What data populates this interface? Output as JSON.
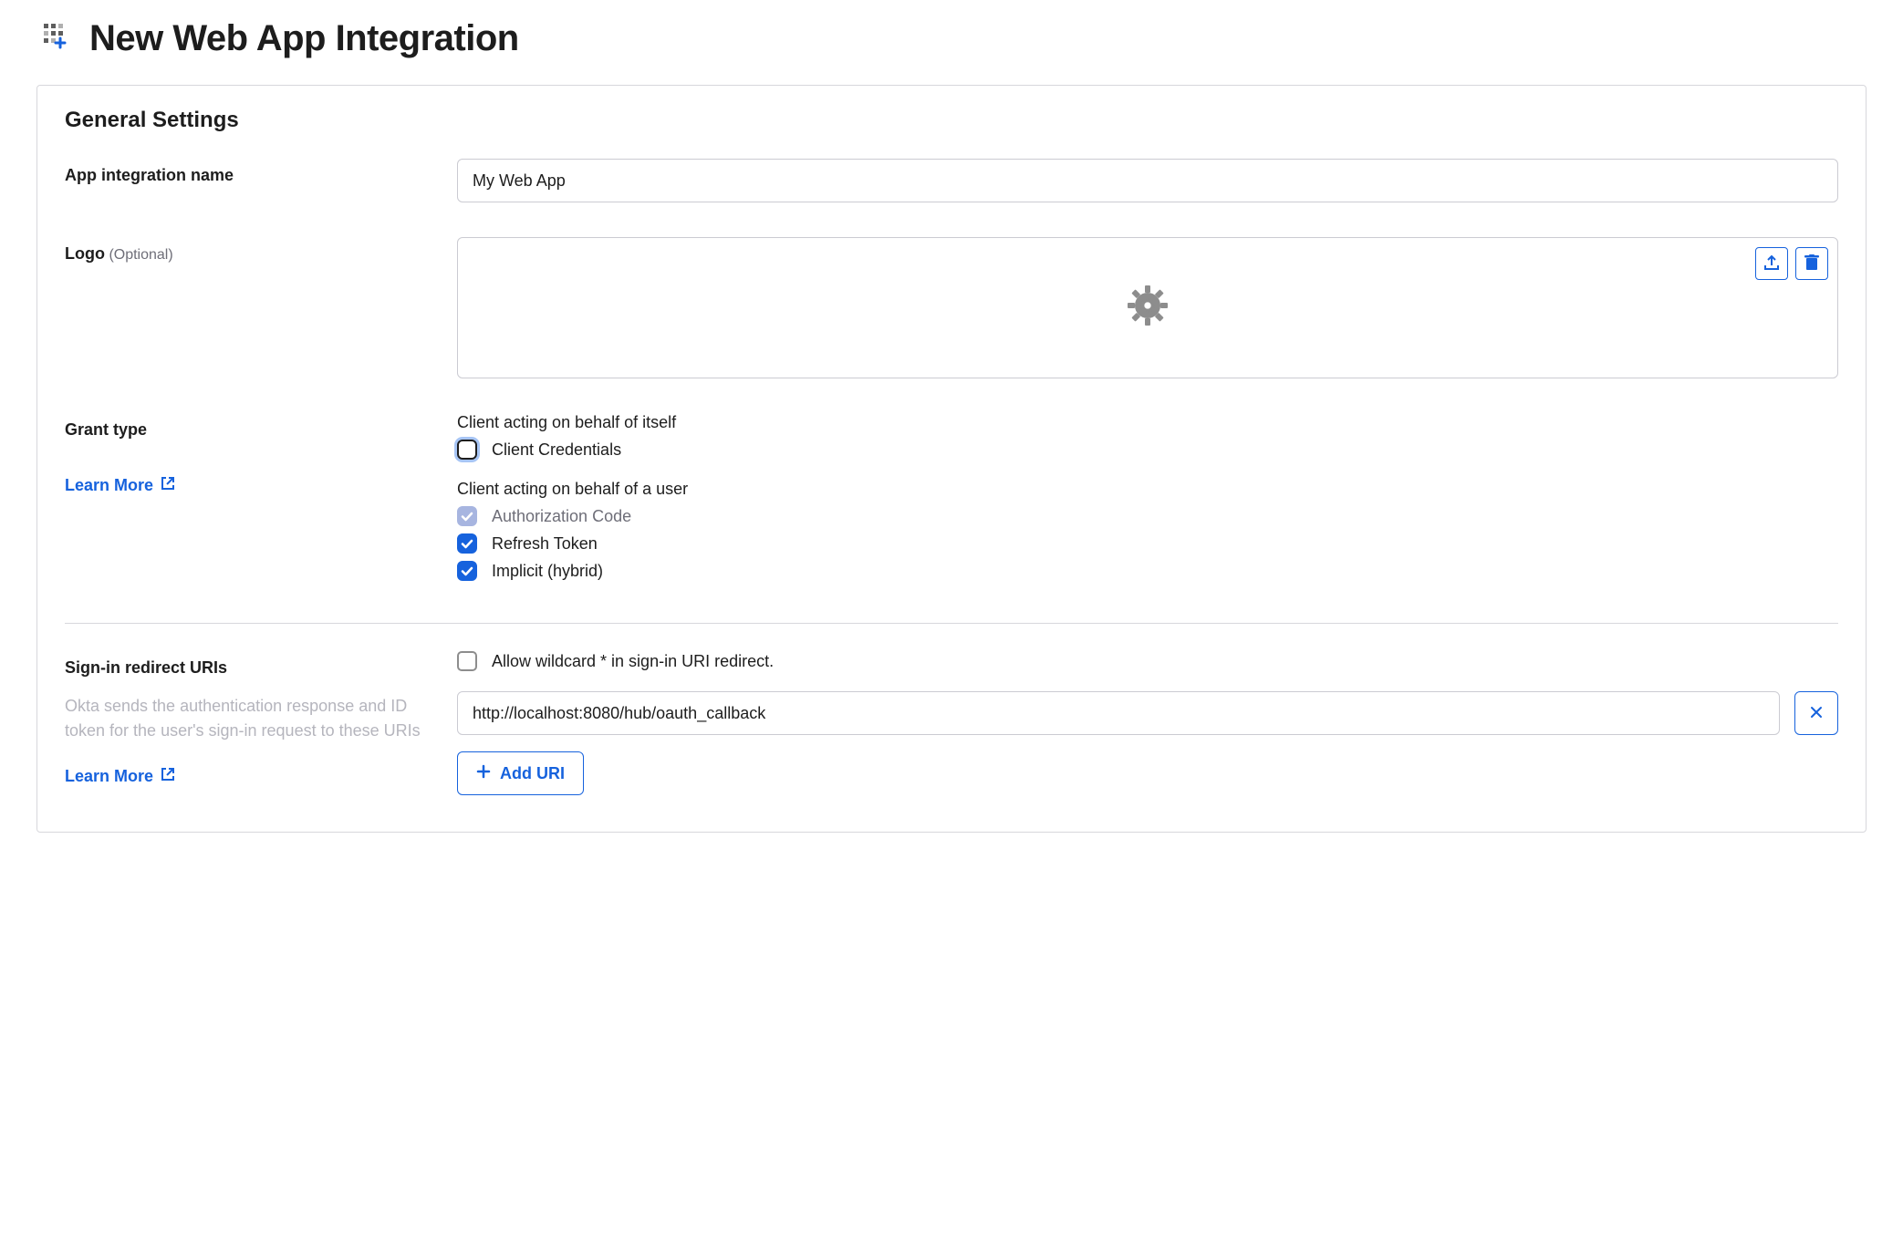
{
  "pageTitle": "New Web App Integration",
  "sectionTitle": "General Settings",
  "fields": {
    "appName": {
      "label": "App integration name",
      "value": "My Web App"
    },
    "logo": {
      "label": "Logo",
      "optional": "(Optional)"
    },
    "grantType": {
      "label": "Grant type",
      "learnMore": "Learn More",
      "groups": {
        "self": {
          "heading": "Client acting on behalf of itself",
          "options": {
            "clientCredentials": {
              "label": "Client Credentials",
              "checked": false
            }
          }
        },
        "user": {
          "heading": "Client acting on behalf of a user",
          "options": {
            "authCode": {
              "label": "Authorization Code",
              "checked": true,
              "disabled": true
            },
            "refreshToken": {
              "label": "Refresh Token",
              "checked": true
            },
            "implicit": {
              "label": "Implicit (hybrid)",
              "checked": true
            }
          }
        }
      }
    },
    "redirectUris": {
      "label": "Sign-in redirect URIs",
      "wildcardLabel": "Allow wildcard * in sign-in URI redirect.",
      "helpText": "Okta sends the authentication response and ID token for the user's sign-in request to these URIs",
      "learnMore": "Learn More",
      "uris": [
        "http://localhost:8080/hub/oauth_callback"
      ],
      "addButton": "Add URI"
    }
  }
}
